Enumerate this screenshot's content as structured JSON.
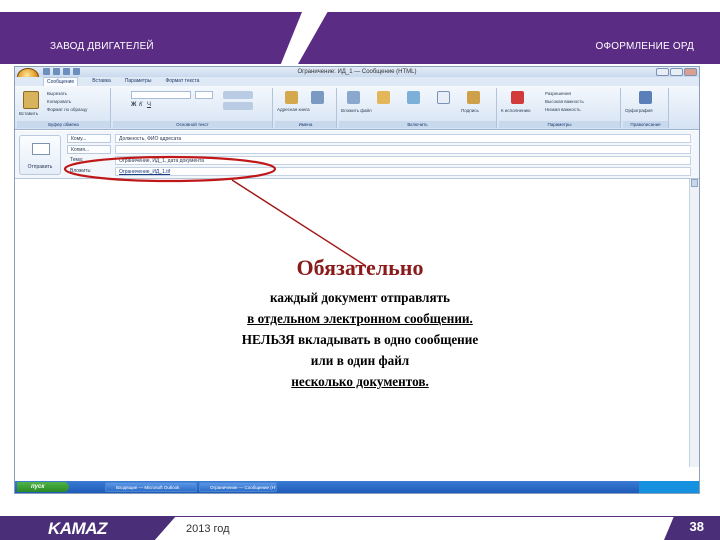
{
  "header": {
    "left_title": "ЗАВОД ДВИГАТЕЛЕЙ",
    "right_title": "ОФОРМЛЕНИЕ ОРД",
    "color": "#5b2c84"
  },
  "outlook": {
    "window_title": "Ограничение: ИД_1 — Сообщение (HTML)",
    "menu_tabs": [
      "Сообщение",
      "Вставка",
      "Параметры",
      "Формат текста"
    ],
    "ribbon_groups": [
      {
        "label": "Буфер обмена",
        "items": [
          "Вставить",
          "Вырезать",
          "Копировать",
          "Формат по образцу"
        ]
      },
      {
        "label": "Основной текст",
        "items": []
      },
      {
        "label": "Имена",
        "items": [
          "Адресная книга",
          "Проверить имена"
        ]
      },
      {
        "label": "Включить",
        "items": [
          "Вложить файл",
          "Вложить элемент",
          "Визитная карточка",
          "Календарь",
          "Подпись"
        ]
      },
      {
        "label": "Параметры",
        "items": [
          "К исполнению",
          "Разрешения",
          "Высокая важность",
          "Низкая важность"
        ]
      },
      {
        "label": "Правописание",
        "items": [
          "Орфография"
        ]
      }
    ],
    "send_label": "Отправить",
    "fields": [
      {
        "label": "Кому...",
        "value": "Должность, ФИО адресата"
      },
      {
        "label": "Копия...",
        "value": ""
      },
      {
        "label": "Тема:",
        "value": "Ограничение, ИД_1, дата документа"
      },
      {
        "label": "Вложить:",
        "value": "Ограничение_ИД_1.tif"
      }
    ],
    "taskbar": {
      "start_label": "пуск",
      "items": [
        "Входящие — Microsoft Outlook",
        "Ограничение — Сообщение (HTML)"
      ]
    }
  },
  "callout": {
    "title": "Обязательно",
    "line1": "каждый документ отправлять",
    "line2": "в отдельном электронном сообщении.",
    "line3": "НЕЛЬЗЯ вкладывать в одно сообщение",
    "line4": "или в один файл",
    "line5": "несколько документов.",
    "color": "#8b1a1a"
  },
  "footer": {
    "logo": "KAMAZ",
    "year": "2013 год",
    "page": "38",
    "color": "#4a2f78"
  }
}
